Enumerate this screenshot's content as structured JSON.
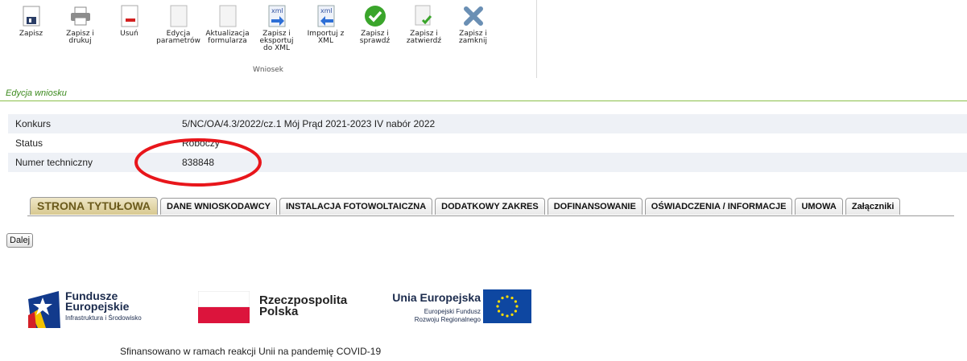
{
  "toolbar": {
    "group_label": "Wniosek",
    "items": [
      {
        "label": "Zapisz",
        "icon": "save-icon"
      },
      {
        "label": "Zapisz i\ndrukuj",
        "icon": "printer-icon"
      },
      {
        "label": "Usuń",
        "icon": "delete-document-icon"
      },
      {
        "label": "Edycja\nparametrów",
        "icon": "edit-document-icon"
      },
      {
        "label": "Aktualizacja\nformularza",
        "icon": "update-document-icon"
      },
      {
        "label": "Zapisz i\neksportuj\ndo XML",
        "icon": "xml-export-icon"
      },
      {
        "label": "Importuj z\nXML",
        "icon": "xml-import-icon"
      },
      {
        "label": "Zapisz i\nsprawdź",
        "icon": "check-icon"
      },
      {
        "label": "Zapisz i\nzatwierdź",
        "icon": "approve-document-icon"
      },
      {
        "label": "Zapisz i\nzamknij",
        "icon": "close-icon"
      }
    ]
  },
  "section_title": "Edycja wniosku",
  "info": {
    "konkurs_label": "Konkurs",
    "konkurs_value": "5/NC/OA/4.3/2022/cz.1 Mój Prąd 2021-2023 IV nabór 2022",
    "status_label": "Status",
    "status_value": "Roboczy",
    "numer_label": "Numer techniczny",
    "numer_value": "838848"
  },
  "tabs": [
    {
      "label": "STRONA TYTUŁOWA",
      "active": true
    },
    {
      "label": "DANE WNIOSKODAWCY"
    },
    {
      "label": "INSTALACJA FOTOWOLTAICZNA"
    },
    {
      "label": "DODATKOWY ZAKRES"
    },
    {
      "label": "DOFINANSOWANIE"
    },
    {
      "label": "OŚWIADCZENIA / INFORMACJE"
    },
    {
      "label": "UMOWA"
    },
    {
      "label": "Załączniki"
    }
  ],
  "next_button": "Dalej",
  "logos": {
    "fe_line1": "Fundusze",
    "fe_line2": "Europejskie",
    "fe_line3": "Infrastruktura i Środowisko",
    "rp_line1": "Rzeczpospolita",
    "rp_line2": "Polska",
    "ue_line1": "Unia Europejska",
    "ue_line2": "Europejski Fundusz",
    "ue_line3": "Rozwoju Regionalnego"
  },
  "footer": "Sfinansowano w ramach reakcji Unii na pandemię COVID-19",
  "colors": {
    "accent_green": "#3c8a1e",
    "annotation_red": "#e8161b",
    "eu_blue": "#0e47a1",
    "eu_star": "#ffde00",
    "pl_red": "#dc143c"
  }
}
